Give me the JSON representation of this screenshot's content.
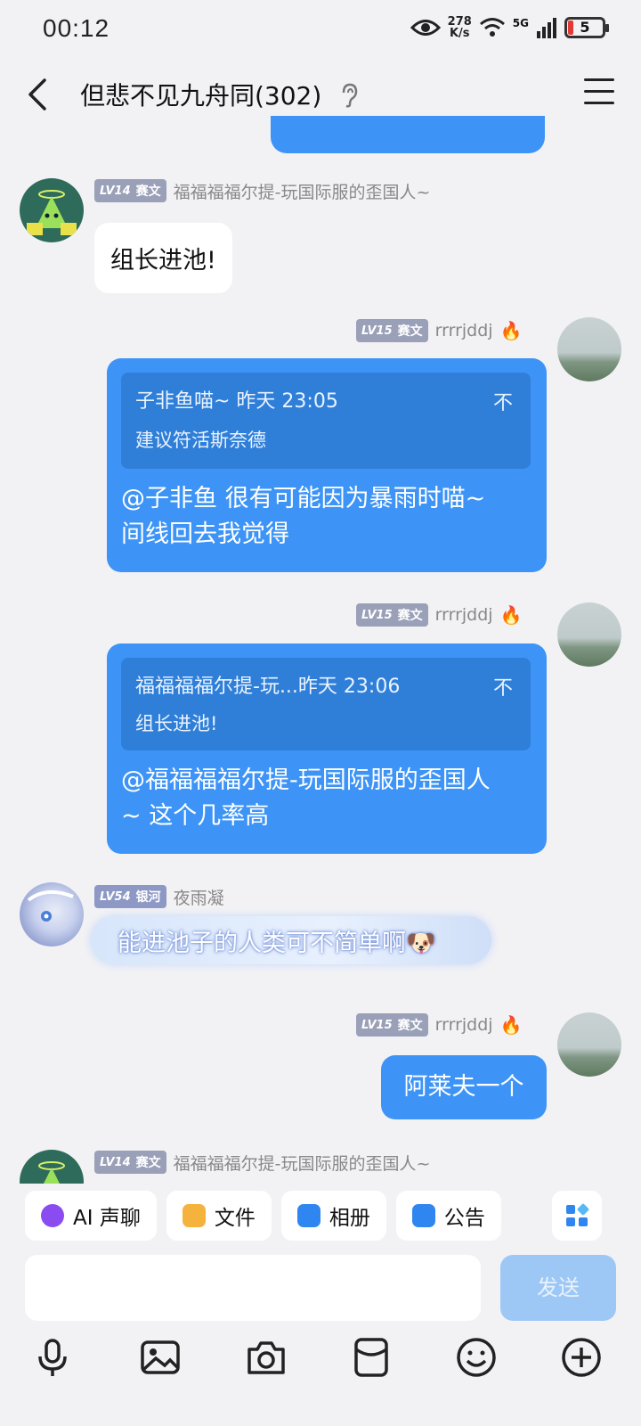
{
  "status_bar": {
    "time": "00:12",
    "net_speed_top": "278",
    "net_speed_bottom": "K/s",
    "network": "5G",
    "battery": "5"
  },
  "header": {
    "title": "但悲不见九舟同(302)"
  },
  "messages": [
    {
      "side": "left",
      "level": "LV14",
      "title_badge": "赛文",
      "nick": "福福福福尔提-玩国际服的歪国人~",
      "text": "组长进池!"
    },
    {
      "side": "right",
      "level": "LV15",
      "title_badge": "赛文",
      "nick": "rrrrjddj",
      "quote_header": "子非鱼喵~ 昨天 23:05",
      "quote_text": "建议符活斯奈德",
      "text_line1": "@子非鱼 很有可能因为暴雨时喵~",
      "text_line2": "间线回去我觉得"
    },
    {
      "side": "right",
      "level": "LV15",
      "title_badge": "赛文",
      "nick": "rrrrjddj",
      "quote_header": "福福福福尔提-玩...昨天 23:06",
      "quote_text": "组长进池!",
      "text_line1": "@福福福福尔提-玩国际服的歪国人",
      "text_line2": "~ 这个几率高"
    },
    {
      "side": "left",
      "level": "LV54",
      "title_badge": "银河",
      "nick": "夜雨凝",
      "text": "能进池子的人类可不简单啊🐶"
    },
    {
      "side": "right",
      "level": "LV15",
      "title_badge": "赛文",
      "nick": "rrrrjddj",
      "text": "阿莱夫一个"
    },
    {
      "side": "left",
      "level": "LV14",
      "title_badge": "赛文",
      "nick": "福福福福尔提-玩国际服的歪国人~"
    }
  ],
  "quick_actions": [
    {
      "label": "AI 声聊",
      "icon": "ai-voice-icon",
      "color": "#8a4cf0"
    },
    {
      "label": "文件",
      "icon": "folder-icon",
      "color": "#f5b23d"
    },
    {
      "label": "相册",
      "icon": "album-icon",
      "color": "#2f86f0"
    },
    {
      "label": "公告",
      "icon": "announcement-icon",
      "color": "#2f86f0"
    }
  ],
  "composer": {
    "send_label": "发送",
    "input_value": ""
  },
  "colors": {
    "accent_blue": "#3d94f6",
    "background": "#f2f2f5"
  }
}
